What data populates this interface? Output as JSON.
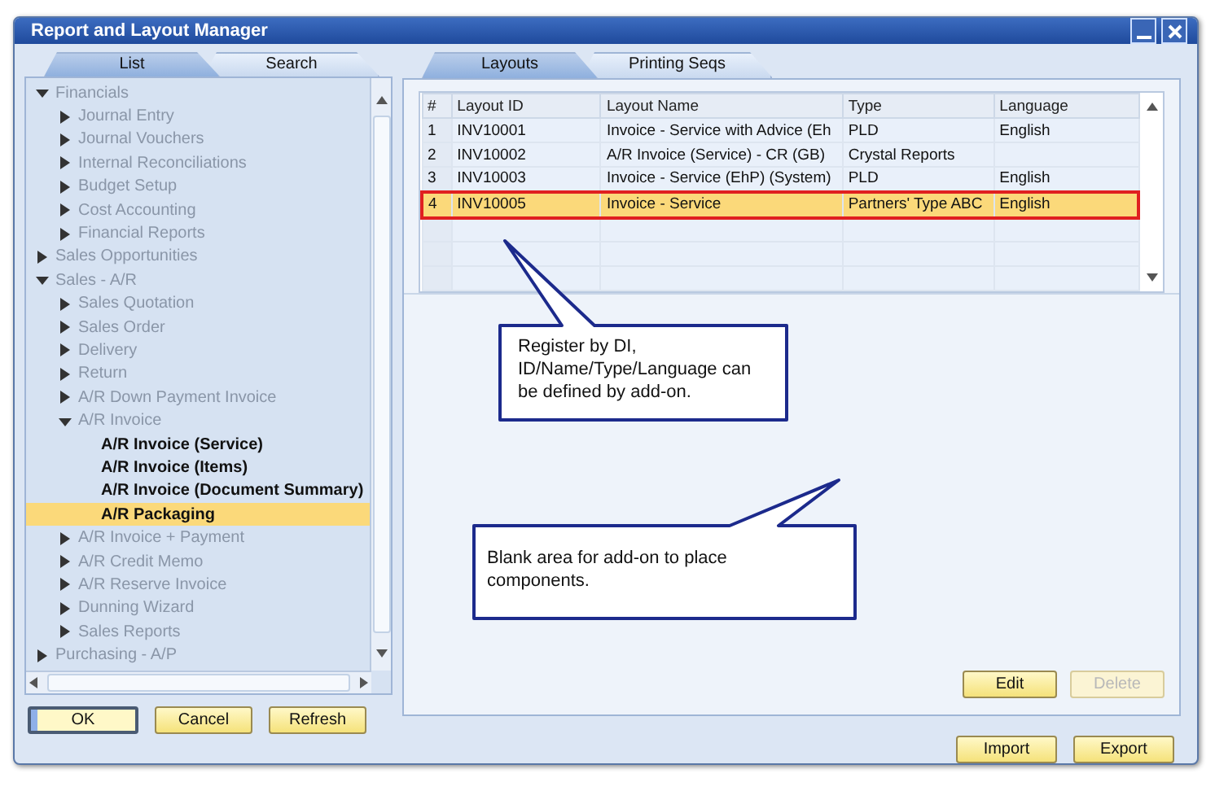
{
  "window": {
    "title": "Report and Layout Manager"
  },
  "left_tabs": [
    {
      "label": "List",
      "selected": true
    },
    {
      "label": "Search",
      "selected": false
    }
  ],
  "tree": [
    {
      "label": "Financials",
      "kind": "folder",
      "expanded": true,
      "selected": false,
      "children": [
        {
          "label": "Journal Entry",
          "kind": "folder",
          "expanded": false,
          "selected": false
        },
        {
          "label": "Journal Vouchers",
          "kind": "folder",
          "expanded": false,
          "selected": false
        },
        {
          "label": "Internal Reconciliations",
          "kind": "folder",
          "expanded": false,
          "selected": false
        },
        {
          "label": "Budget Setup",
          "kind": "folder",
          "expanded": false,
          "selected": false
        },
        {
          "label": "Cost Accounting",
          "kind": "folder",
          "expanded": false,
          "selected": false
        },
        {
          "label": "Financial Reports",
          "kind": "folder",
          "expanded": false,
          "selected": false
        }
      ]
    },
    {
      "label": "Sales Opportunities",
      "kind": "folder",
      "expanded": false,
      "selected": false
    },
    {
      "label": "Sales - A/R",
      "kind": "folder",
      "expanded": true,
      "selected": false,
      "children": [
        {
          "label": "Sales Quotation",
          "kind": "folder",
          "expanded": false,
          "selected": false
        },
        {
          "label": "Sales Order",
          "kind": "folder",
          "expanded": false,
          "selected": false
        },
        {
          "label": "Delivery",
          "kind": "folder",
          "expanded": false,
          "selected": false
        },
        {
          "label": "Return",
          "kind": "folder",
          "expanded": false,
          "selected": false
        },
        {
          "label": "A/R Down Payment Invoice",
          "kind": "folder",
          "expanded": false,
          "selected": false
        },
        {
          "label": "A/R Invoice",
          "kind": "folder",
          "expanded": true,
          "selected": false,
          "children": [
            {
              "label": "A/R Invoice (Service)",
              "kind": "layout",
              "selected": false
            },
            {
              "label": "A/R Invoice (Items)",
              "kind": "layout",
              "selected": false
            },
            {
              "label": "A/R Invoice (Document Summary)",
              "kind": "layout",
              "selected": false
            },
            {
              "label": "A/R Packaging",
              "kind": "layout",
              "selected": true
            }
          ]
        },
        {
          "label": "A/R Invoice + Payment",
          "kind": "folder",
          "expanded": false,
          "selected": false
        },
        {
          "label": "A/R Credit Memo",
          "kind": "folder",
          "expanded": false,
          "selected": false
        },
        {
          "label": "A/R Reserve Invoice",
          "kind": "folder",
          "expanded": false,
          "selected": false
        },
        {
          "label": "Dunning Wizard",
          "kind": "folder",
          "expanded": false,
          "selected": false
        },
        {
          "label": "Sales Reports",
          "kind": "folder",
          "expanded": false,
          "selected": false
        }
      ]
    },
    {
      "label": "Purchasing - A/P",
      "kind": "folder",
      "expanded": false,
      "selected": false
    }
  ],
  "left_buttons": [
    {
      "label": "OK",
      "focused": true
    },
    {
      "label": "Cancel",
      "focused": false
    },
    {
      "label": "Refresh",
      "focused": false
    }
  ],
  "right_tabs": [
    {
      "label": "Layouts",
      "selected": true
    },
    {
      "label": "Printing Seqs",
      "selected": false
    }
  ],
  "table": {
    "columns": [
      "#",
      "Layout ID",
      "Layout Name",
      "Type",
      "Language"
    ],
    "rows": [
      {
        "cells": [
          "1",
          "INV10001",
          "Invoice - Service with Advice (Eh",
          "PLD",
          "English"
        ],
        "selected": false,
        "outlined": false
      },
      {
        "cells": [
          "2",
          "INV10002",
          "A/R Invoice (Service) - CR (GB)",
          "Crystal Reports",
          ""
        ],
        "selected": false,
        "outlined": false
      },
      {
        "cells": [
          "3",
          "INV10003",
          "Invoice - Service (EhP) (System)",
          "PLD",
          "English"
        ],
        "selected": false,
        "outlined": false
      },
      {
        "cells": [
          "4",
          "INV10005",
          "Invoice - Service",
          "Partners' Type ABC",
          "English"
        ],
        "selected": true,
        "outlined": true
      }
    ]
  },
  "callouts": [
    "Register by DI, ID/Name/Type/Language can be defined by add-on.",
    "Blank area for add-on to place components."
  ],
  "panel_buttons": [
    {
      "label": "Edit",
      "disabled": false
    },
    {
      "label": "Delete",
      "disabled": true
    }
  ],
  "bottom_buttons": [
    {
      "label": "Import",
      "disabled": false
    },
    {
      "label": "Export",
      "disabled": false
    }
  ]
}
